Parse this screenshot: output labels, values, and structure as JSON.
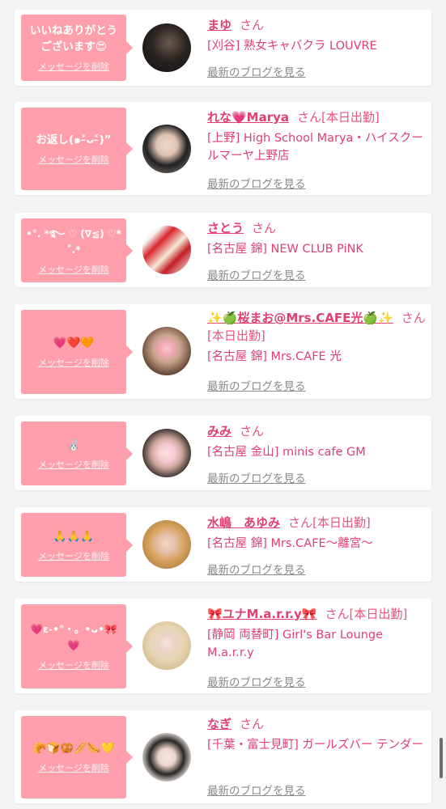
{
  "delete_label": "メッセージを削除",
  "blog_label": "最新のブログを見る",
  "san_label": "さん",
  "colors": {
    "bubble": "#ff9fab",
    "accent": "#e0406f",
    "background": "#f3f3f3"
  },
  "entries": [
    {
      "message": "いいねありがとうございます😍",
      "name": "まゆ",
      "badge": "",
      "shop": "[刈谷] 熟女キャバクラ LOUVRE"
    },
    {
      "message": "お返し(๑˃̵ᴗ˂̵)”",
      "name": "れな💗Marya",
      "badge": "[本日出勤]",
      "shop": "[上野] High School Marya・ハイスクールマーヤ上野店"
    },
    {
      "message": "•°. *࿐ ♡ (∇≦) ♡*˚.*",
      "name": "さとう",
      "badge": "",
      "shop": "[名古屋 錦] NEW CLUB PiNK"
    },
    {
      "message": "💗❤️🧡",
      "name": "✨🍏桜まお@Mrs.CAFE光🍏✨",
      "badge": "[本日出勤]",
      "shop": "[名古屋 錦] Mrs.CAFE 光"
    },
    {
      "message": "🐰",
      "name": "みみ",
      "badge": "",
      "shop": "[名古屋 金山] minis cafe GM"
    },
    {
      "message": "🙏🙏🙏",
      "name": "水嶋　あゆみ",
      "badge": "[本日出勤]",
      "shop": "[名古屋 錦] Mrs.CAFE～離宮～"
    },
    {
      "message": "💗ε-•°・。•ᴗ•🎀💗",
      "name": "🎀ユナM.a.r.r.y🎀",
      "badge": "[本日出勤]",
      "shop": "[静岡 両替町] Girl's Bar Lounge M.a.r.r.y"
    },
    {
      "message": "🥐🍞🥨🥖🌭💛",
      "name": "なぎ",
      "badge": "",
      "shop": "[千葉・富士見町] ガールズバー テンダー"
    }
  ]
}
